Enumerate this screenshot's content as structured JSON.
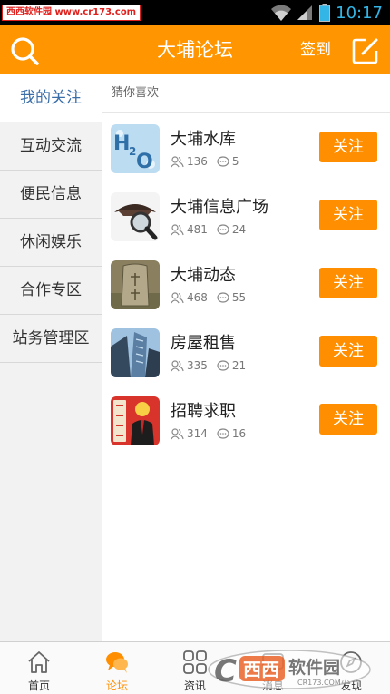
{
  "status_bar": {
    "watermark": "西西软件园 www.cr173.com",
    "time": "10:17"
  },
  "header": {
    "title": "大埔论坛",
    "signin_label": "签到"
  },
  "sidebar": {
    "items": [
      {
        "label": "我的关注"
      },
      {
        "label": "互动交流"
      },
      {
        "label": "便民信息"
      },
      {
        "label": "休闲娱乐"
      },
      {
        "label": "合作专区"
      },
      {
        "label": "站务管理区"
      }
    ]
  },
  "main": {
    "section_title": "猜你喜欢",
    "forums": [
      {
        "name": "大埔水库",
        "members": "136",
        "posts": "5",
        "follow_label": "关注",
        "thumb": "h2o-icon"
      },
      {
        "name": "大埔信息广场",
        "members": "481",
        "posts": "24",
        "follow_label": "关注",
        "thumb": "magnifier-icon"
      },
      {
        "name": "大埔动态",
        "members": "468",
        "posts": "55",
        "follow_label": "关注",
        "thumb": "stone-tablet-icon"
      },
      {
        "name": "房屋租售",
        "members": "335",
        "posts": "21",
        "follow_label": "关注",
        "thumb": "buildings-icon"
      },
      {
        "name": "招聘求职",
        "members": "314",
        "posts": "16",
        "follow_label": "关注",
        "thumb": "job-seeker-icon"
      }
    ]
  },
  "bottom_nav": {
    "items": [
      {
        "label": "首页",
        "icon": "home-icon"
      },
      {
        "label": "论坛",
        "icon": "chat-bubbles-icon"
      },
      {
        "label": "资讯",
        "icon": "grid-icon"
      },
      {
        "label": "消息",
        "icon": "message-icon"
      },
      {
        "label": "发现",
        "icon": "discover-icon"
      }
    ]
  },
  "watermark_logo": {
    "text": "西西软件园",
    "sub": "CR173.COM"
  },
  "colors": {
    "accent": "#ff9500",
    "button": "#ff8f00",
    "active_side": "#3a6ea8"
  }
}
